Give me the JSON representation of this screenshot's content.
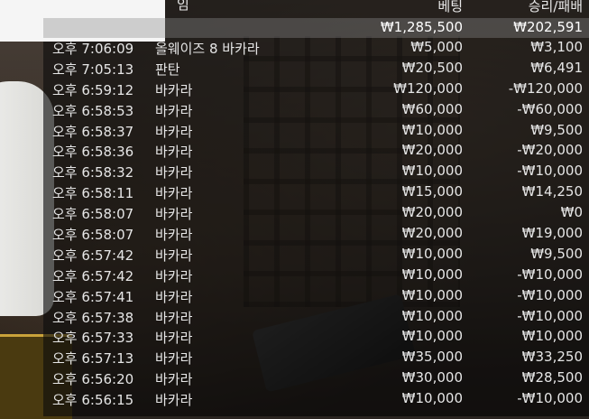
{
  "columns": {
    "game_partial": "임",
    "bet": "베팅",
    "win_loss": "승리/패배"
  },
  "total": {
    "bet": "₩1,285,500",
    "win_loss": "₩202,591"
  },
  "rows": [
    {
      "time": "오후 7:06:09",
      "game": "올웨이즈 8 바카라",
      "bet": "₩5,000",
      "win_loss": "₩3,100"
    },
    {
      "time": "오후 7:05:13",
      "game": "판탄",
      "bet": "₩20,500",
      "win_loss": "₩6,491"
    },
    {
      "time": "오후 6:59:12",
      "game": "바카라",
      "bet": "₩120,000",
      "win_loss": "-₩120,000"
    },
    {
      "time": "오후 6:58:53",
      "game": "바카라",
      "bet": "₩60,000",
      "win_loss": "-₩60,000"
    },
    {
      "time": "오후 6:58:37",
      "game": "바카라",
      "bet": "₩10,000",
      "win_loss": "₩9,500"
    },
    {
      "time": "오후 6:58:36",
      "game": "바카라",
      "bet": "₩20,000",
      "win_loss": "-₩20,000"
    },
    {
      "time": "오후 6:58:32",
      "game": "바카라",
      "bet": "₩10,000",
      "win_loss": "-₩10,000"
    },
    {
      "time": "오후 6:58:11",
      "game": "바카라",
      "bet": "₩15,000",
      "win_loss": "₩14,250"
    },
    {
      "time": "오후 6:58:07",
      "game": "바카라",
      "bet": "₩20,000",
      "win_loss": "₩0"
    },
    {
      "time": "오후 6:58:07",
      "game": "바카라",
      "bet": "₩20,000",
      "win_loss": "₩19,000"
    },
    {
      "time": "오후 6:57:42",
      "game": "바카라",
      "bet": "₩10,000",
      "win_loss": "₩9,500"
    },
    {
      "time": "오후 6:57:42",
      "game": "바카라",
      "bet": "₩10,000",
      "win_loss": "-₩10,000"
    },
    {
      "time": "오후 6:57:41",
      "game": "바카라",
      "bet": "₩10,000",
      "win_loss": "-₩10,000"
    },
    {
      "time": "오후 6:57:38",
      "game": "바카라",
      "bet": "₩10,000",
      "win_loss": "-₩10,000"
    },
    {
      "time": "오후 6:57:33",
      "game": "바카라",
      "bet": "₩10,000",
      "win_loss": "₩10,000"
    },
    {
      "time": "오후 6:57:13",
      "game": "바카라",
      "bet": "₩35,000",
      "win_loss": "₩33,250"
    },
    {
      "time": "오후 6:56:20",
      "game": "바카라",
      "bet": "₩30,000",
      "win_loss": "₩28,500"
    },
    {
      "time": "오후 6:56:15",
      "game": "바카라",
      "bet": "₩10,000",
      "win_loss": "-₩10,000"
    }
  ]
}
